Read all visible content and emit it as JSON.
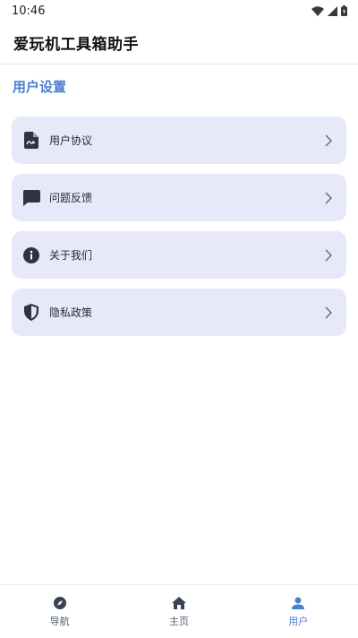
{
  "status": {
    "time": "10:46",
    "icons": [
      "wifi-icon",
      "signal-icon",
      "battery-icon"
    ]
  },
  "app": {
    "title": "爱玩机工具箱助手"
  },
  "section": {
    "title": "用户设置"
  },
  "settings": [
    {
      "label": "用户协议",
      "icon": "document-icon"
    },
    {
      "label": "问题反馈",
      "icon": "chat-icon"
    },
    {
      "label": "关于我们",
      "icon": "info-icon"
    },
    {
      "label": "隐私政策",
      "icon": "shield-icon"
    }
  ],
  "nav": [
    {
      "label": "导航",
      "icon": "compass-icon",
      "active": false
    },
    {
      "label": "主页",
      "icon": "home-icon",
      "active": false
    },
    {
      "label": "用户",
      "icon": "user-icon",
      "active": true
    }
  ],
  "colors": {
    "accent": "#4a7fd0",
    "card_bg": "#e8e8fb",
    "icon_dark": "#2f3441"
  }
}
